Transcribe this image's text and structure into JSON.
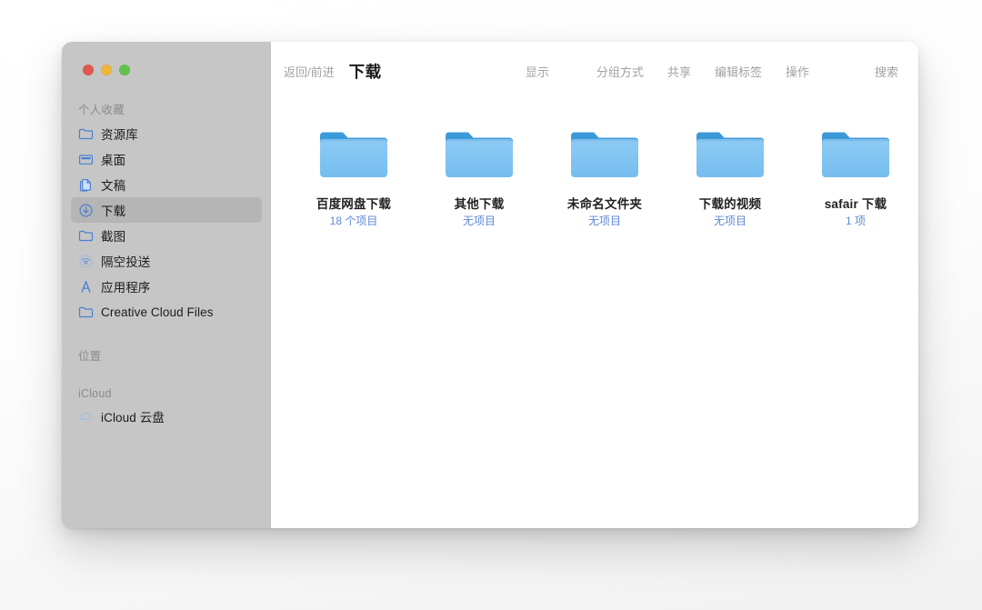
{
  "window": {
    "traffic_lights": [
      {
        "name": "close",
        "color": "#e0584f"
      },
      {
        "name": "minimize",
        "color": "#edb63c"
      },
      {
        "name": "zoom",
        "color": "#61c14c"
      }
    ]
  },
  "sidebar": {
    "sections": [
      {
        "header": "个人收藏",
        "items": [
          {
            "label": "资源库",
            "icon": "folder-icon",
            "selected": false
          },
          {
            "label": "桌面",
            "icon": "desktop-icon",
            "selected": false
          },
          {
            "label": "文稿",
            "icon": "documents-icon",
            "selected": false
          },
          {
            "label": "下载",
            "icon": "downloads-icon",
            "selected": true
          },
          {
            "label": "截图",
            "icon": "folder-icon",
            "selected": false
          },
          {
            "label": "隔空投送",
            "icon": "airdrop-icon",
            "selected": false
          },
          {
            "label": "应用程序",
            "icon": "applications-icon",
            "selected": false
          },
          {
            "label": "Creative Cloud Files",
            "icon": "folder-icon",
            "selected": false
          }
        ]
      },
      {
        "header": "位置",
        "items": []
      },
      {
        "header": "iCloud",
        "items": [
          {
            "label": "iCloud 云盘",
            "icon": "cloud-icon",
            "selected": false
          }
        ]
      }
    ]
  },
  "toolbar": {
    "back_forward": "返回/前进",
    "title": "下载",
    "view": "显示",
    "group_by": "分组方式",
    "share": "共享",
    "edit_tags": "编辑标签",
    "action": "操作",
    "search": "搜索"
  },
  "files": [
    {
      "name": "百度网盘下载",
      "count": "18 个项目"
    },
    {
      "name": "其他下载",
      "count": "无项目"
    },
    {
      "name": "未命名文件夹",
      "count": "无项目"
    },
    {
      "name": "下载的视频",
      "count": "无项目"
    },
    {
      "name": "safair 下载",
      "count": "1 项"
    }
  ],
  "colors": {
    "sidebar_bg": "#c6c6c6",
    "sidebar_selected": "#b5b5b5",
    "content_bg": "#ffffff",
    "folder_body": "#7ec2f0",
    "folder_tab": "#3d9ad9",
    "count_text": "#5b89d6",
    "sidebar_icon": "#4a7fd4"
  }
}
